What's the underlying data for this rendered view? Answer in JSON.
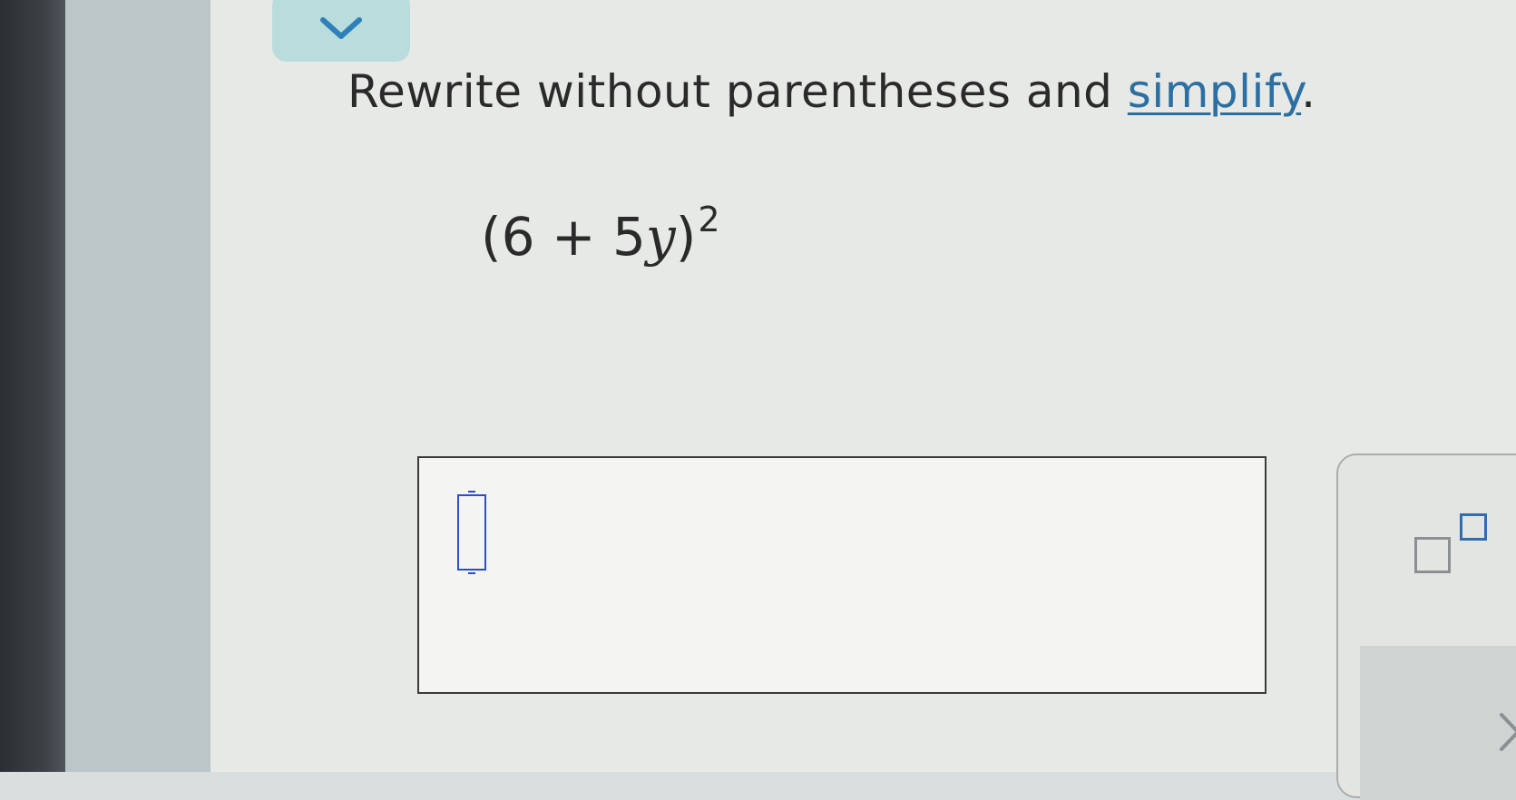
{
  "question": {
    "instruction_prefix": "Rewrite without parentheses and ",
    "instruction_link": "simplify",
    "instruction_suffix": ".",
    "expression": {
      "open": "(6 + 5",
      "variable": "y",
      "close": ")",
      "exponent": "2"
    }
  },
  "answer": {
    "value": ""
  },
  "icons": {
    "collapse": "chevron-down-icon",
    "exponent": "exponent-template-icon",
    "next": "chevron-right-icon"
  },
  "colors": {
    "link": "#2c6fa3",
    "cursor_field": "#2a4fc7",
    "collapse_button": "#b9dcdc"
  }
}
